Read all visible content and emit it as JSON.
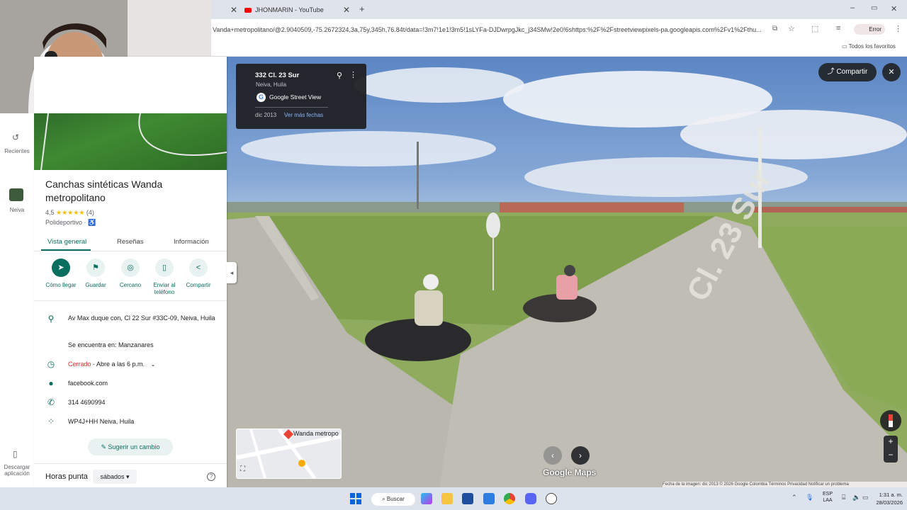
{
  "browser": {
    "active_tab_title": "JHONMARIN - YouTube",
    "url": "Vanda+metropolitano/@2.9040509,-75.2672324,3a,75y,345h,76.84t/data=!3m7!1e1!3m5!1sLYFa-DJDwrpgJkc_j34SMw!2e0!6shttps:%2F%2Fstreetviewpixels-pa.googleapis.com%2Fv1%2Fthu...",
    "profile_label": "Error",
    "bookmarks_label": "Todos los favoritos"
  },
  "rail": {
    "recents_label": "Recientes",
    "city_label": "Neiva",
    "download_label": "Descargar aplicación"
  },
  "place": {
    "title": "Canchas sintéticas Wanda metropolitano",
    "rating_text": "4,5",
    "stars": "★★★★★",
    "review_count": "(4)",
    "category": "Polideportivo ·",
    "accessibility_icon": "♿",
    "tabs": [
      "Vista general",
      "Reseñas",
      "Información"
    ],
    "actions": [
      {
        "icon": "directions-icon",
        "glyph": "➤",
        "label": "Cómo llegar"
      },
      {
        "icon": "bookmark-icon",
        "glyph": "⚑",
        "label": "Guardar"
      },
      {
        "icon": "nearby-icon",
        "glyph": "◎",
        "label": "Cercano"
      },
      {
        "icon": "phone-send-icon",
        "glyph": "▯",
        "label": "Enviar al teléfono"
      },
      {
        "icon": "share-icon",
        "glyph": "<",
        "label": "Compartir"
      }
    ],
    "address": "Av Max duque con, Cl 22 Sur #33C-09, Neiva, Huila",
    "located_in": "Se encuentra en: Manzanares",
    "hours_status": "Cerrado",
    "hours_detail": " · Abre a las 6 p.m.",
    "website": "facebook.com",
    "phone": "314 4690994",
    "plus_code": "WP4J+HH Neiva, Huila",
    "suggest_label": "Sugerir un cambio",
    "peak_title": "Horas punta",
    "peak_day": "sábados",
    "help_glyph": "?"
  },
  "streetview": {
    "address": "332 Cl. 23 Sur",
    "city": "Neiva, Huila",
    "provider": "Google Street View",
    "date": "dic 2013",
    "more_dates": "Ver más fechas",
    "share_label": "Compartir",
    "street_label": "Cl. 23 Sur",
    "minimap_label": "Wanda metropo",
    "maps_logo": "Google Maps",
    "attribution": "Fecha de la imagen: dic 2013   © 2026 Google   Colombia   Términos   Privacidad   Notificar un problema"
  },
  "taskbar": {
    "search_label": "Buscar",
    "lang_line1": "ESP",
    "lang_line2": "LAA",
    "time": "1:31 a. m.",
    "date": "28/03/2026"
  },
  "colors": {
    "accent": "#0b6f5f",
    "closed": "#d93025",
    "panel_bg": "#ffffff"
  }
}
